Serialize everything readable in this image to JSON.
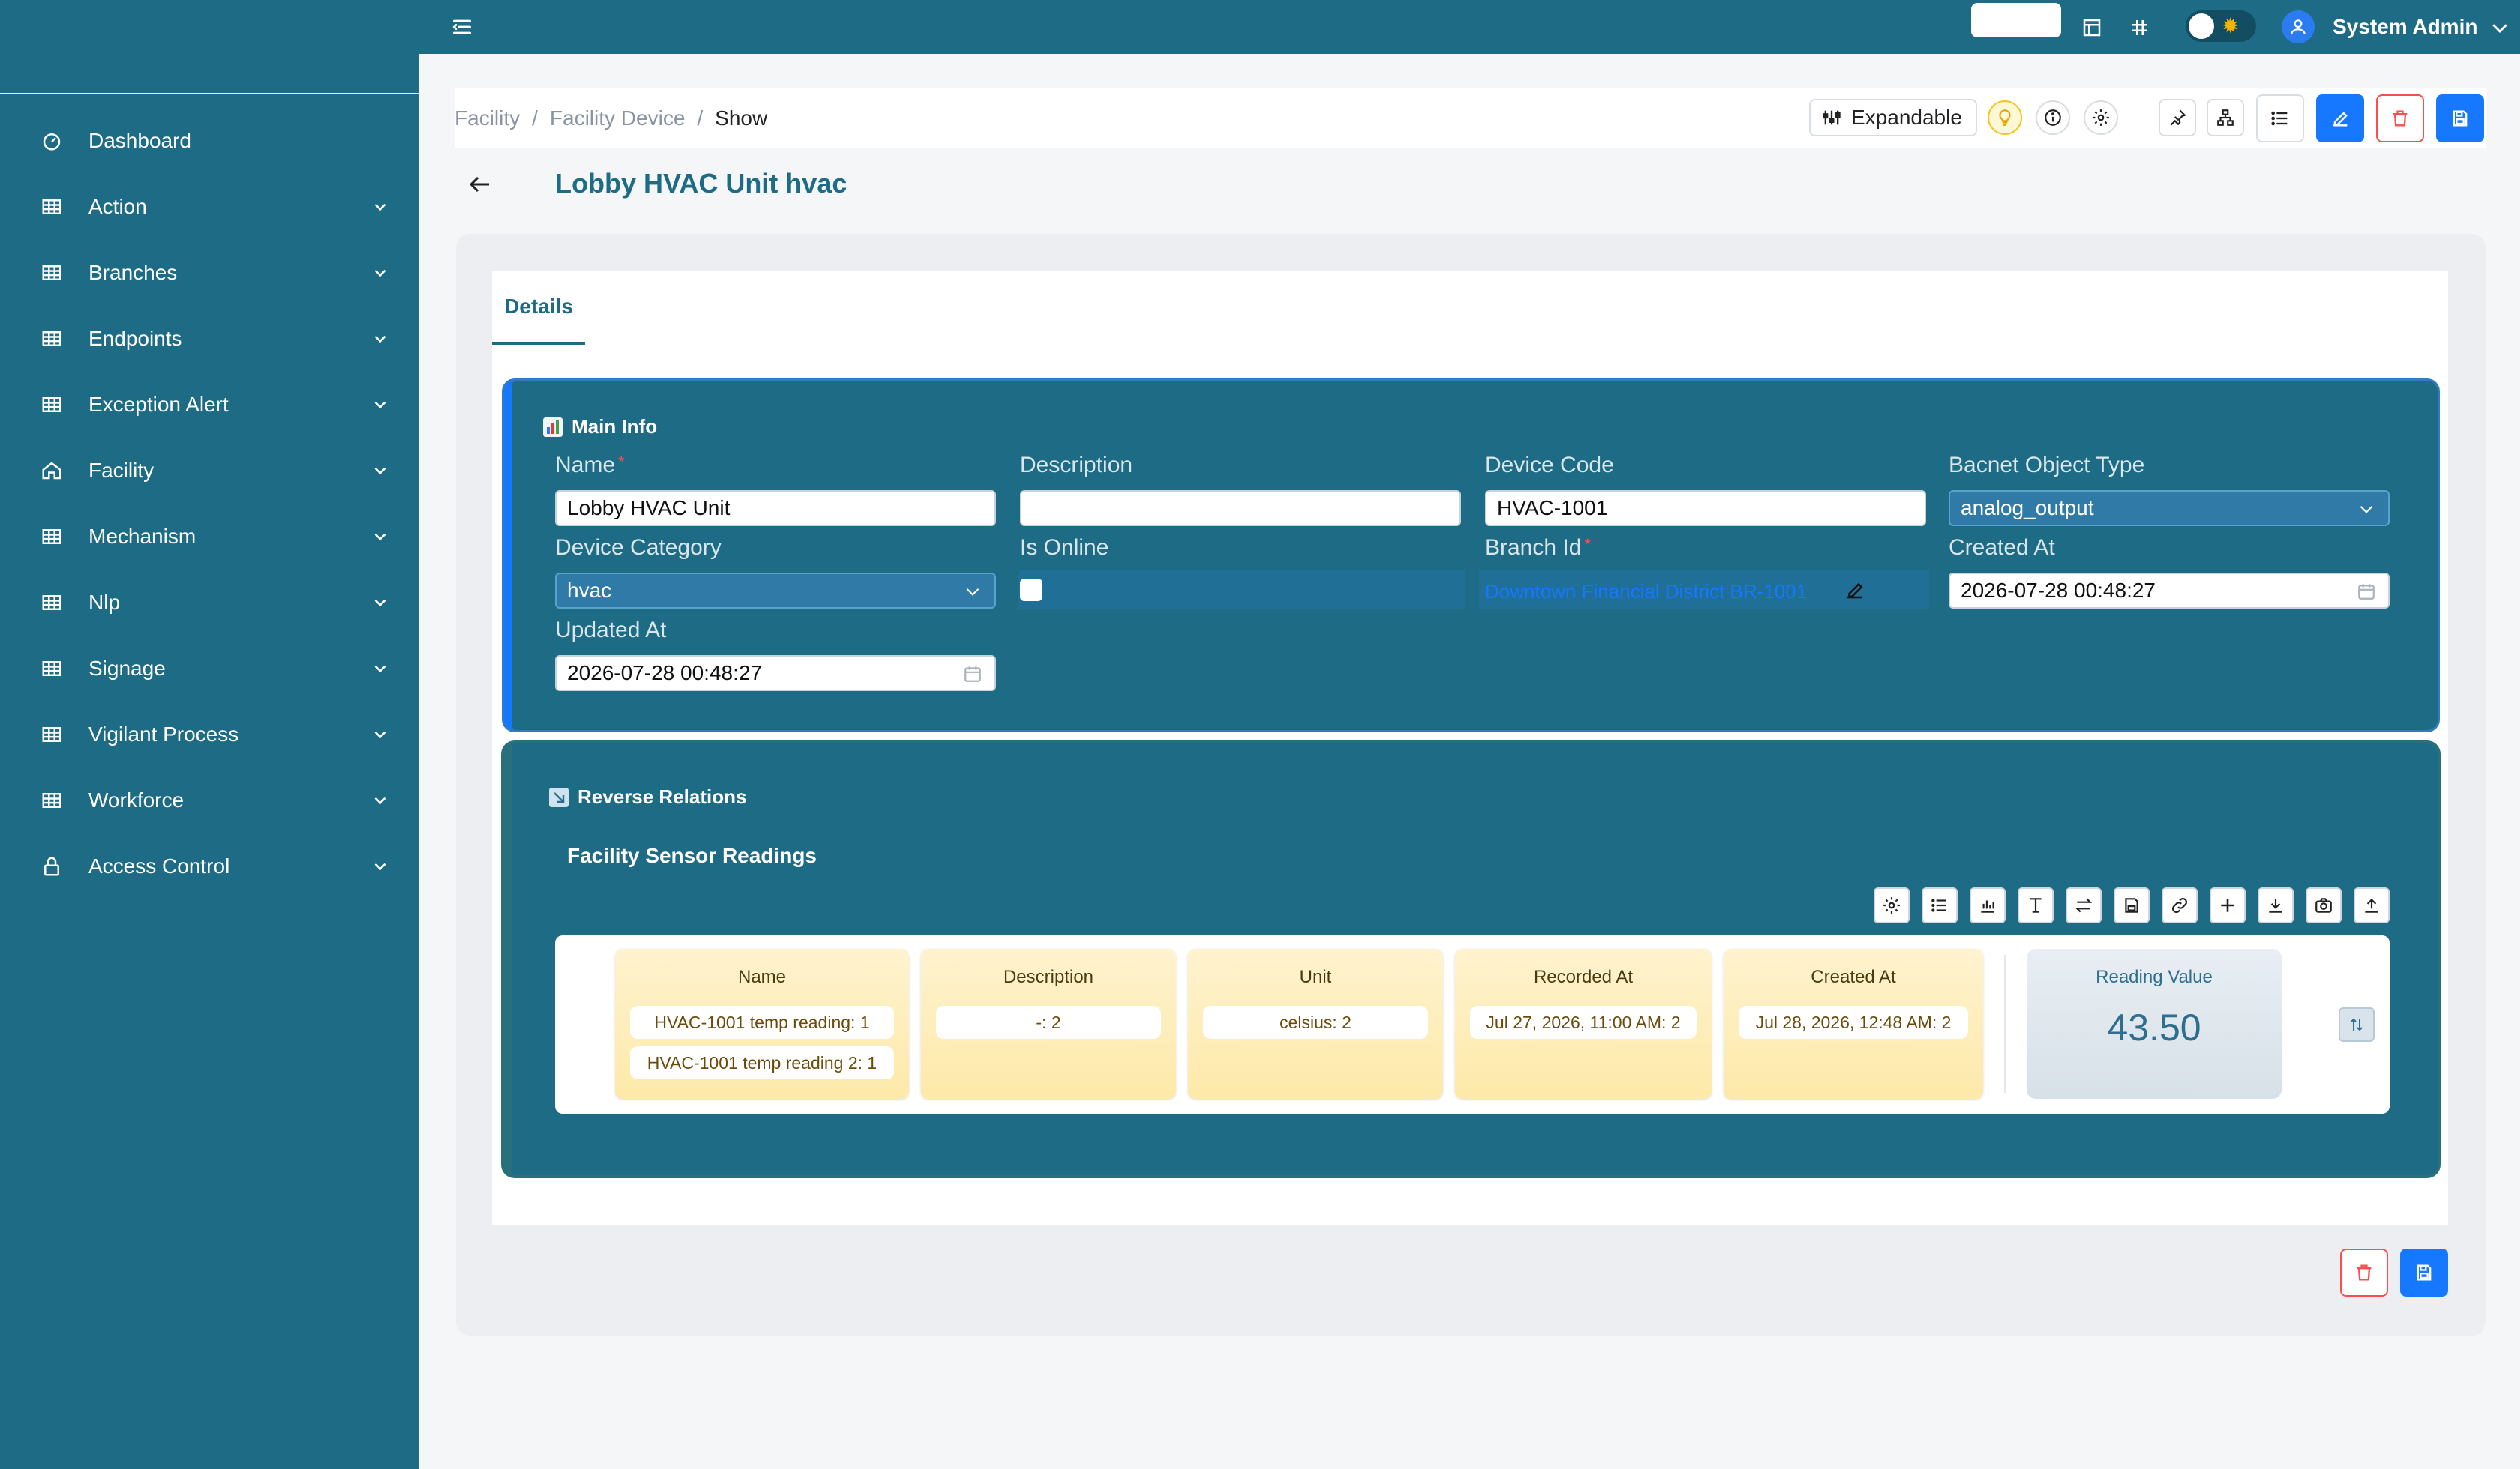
{
  "sidebar": {
    "items": [
      {
        "label": "Dashboard",
        "icon": "dashboard-icon",
        "has_children": false
      },
      {
        "label": "Action",
        "icon": "table-icon",
        "has_children": true
      },
      {
        "label": "Branches",
        "icon": "table-icon",
        "has_children": true
      },
      {
        "label": "Endpoints",
        "icon": "table-icon",
        "has_children": true
      },
      {
        "label": "Exception Alert",
        "icon": "table-icon",
        "has_children": true
      },
      {
        "label": "Facility",
        "icon": "home-icon",
        "has_children": true
      },
      {
        "label": "Mechanism",
        "icon": "table-icon",
        "has_children": true
      },
      {
        "label": "Nlp",
        "icon": "table-icon",
        "has_children": true
      },
      {
        "label": "Signage",
        "icon": "table-icon",
        "has_children": true
      },
      {
        "label": "Vigilant Process",
        "icon": "table-icon",
        "has_children": true
      },
      {
        "label": "Workforce",
        "icon": "table-icon",
        "has_children": true
      },
      {
        "label": "Access Control",
        "icon": "lock-icon",
        "has_children": true
      }
    ]
  },
  "topbar": {
    "user_name": "System Admin",
    "theme_toggle_icon": "sun-icon"
  },
  "breadcrumb": {
    "items": [
      "Facility",
      "Facility Device",
      "Show"
    ],
    "separator": "/"
  },
  "toolbar": {
    "expandable_label": "Expandable"
  },
  "page": {
    "title": "Lobby HVAC Unit hvac"
  },
  "tabs": [
    {
      "label": "Details",
      "active": true
    }
  ],
  "main_info": {
    "title": "Main Info",
    "fields": {
      "name": {
        "label": "Name",
        "value": "Lobby HVAC Unit",
        "required": true
      },
      "description": {
        "label": "Description",
        "value": ""
      },
      "device_code": {
        "label": "Device Code",
        "value": "HVAC-1001"
      },
      "bacnet_object_type": {
        "label": "Bacnet Object Type",
        "value": "analog_output"
      },
      "device_category": {
        "label": "Device Category",
        "value": "hvac"
      },
      "is_online": {
        "label": "Is Online",
        "value": false
      },
      "branch_id": {
        "label": "Branch Id",
        "value": "Downtown Financial District BR-1001",
        "required": true
      },
      "created_at": {
        "label": "Created At",
        "value": "2026-07-28 00:48:27"
      },
      "updated_at": {
        "label": "Updated At",
        "value": "2026-07-28 00:48:27"
      }
    }
  },
  "reverse_relations": {
    "title": "Reverse Relations",
    "subtitle": "Facility Sensor Readings",
    "columns": [
      {
        "header": "Name",
        "values": [
          "HVAC-1001 temp reading: 1",
          "HVAC-1001 temp reading 2: 1"
        ]
      },
      {
        "header": "Description",
        "values": [
          "-: 2"
        ]
      },
      {
        "header": "Unit",
        "values": [
          "celsius: 2"
        ]
      },
      {
        "header": "Recorded At",
        "values": [
          "Jul 27, 2026, 11:00 AM: 2"
        ]
      },
      {
        "header": "Created At",
        "values": [
          "Jul 28, 2026, 12:48 AM: 2"
        ]
      }
    ],
    "metric": {
      "label": "Reading Value",
      "value": "43.50"
    }
  },
  "colors": {
    "primary": "#1e6b85",
    "accent_blue": "#1677ff",
    "danger": "#ff4d4f",
    "card_yellow": "#fde9a9"
  }
}
